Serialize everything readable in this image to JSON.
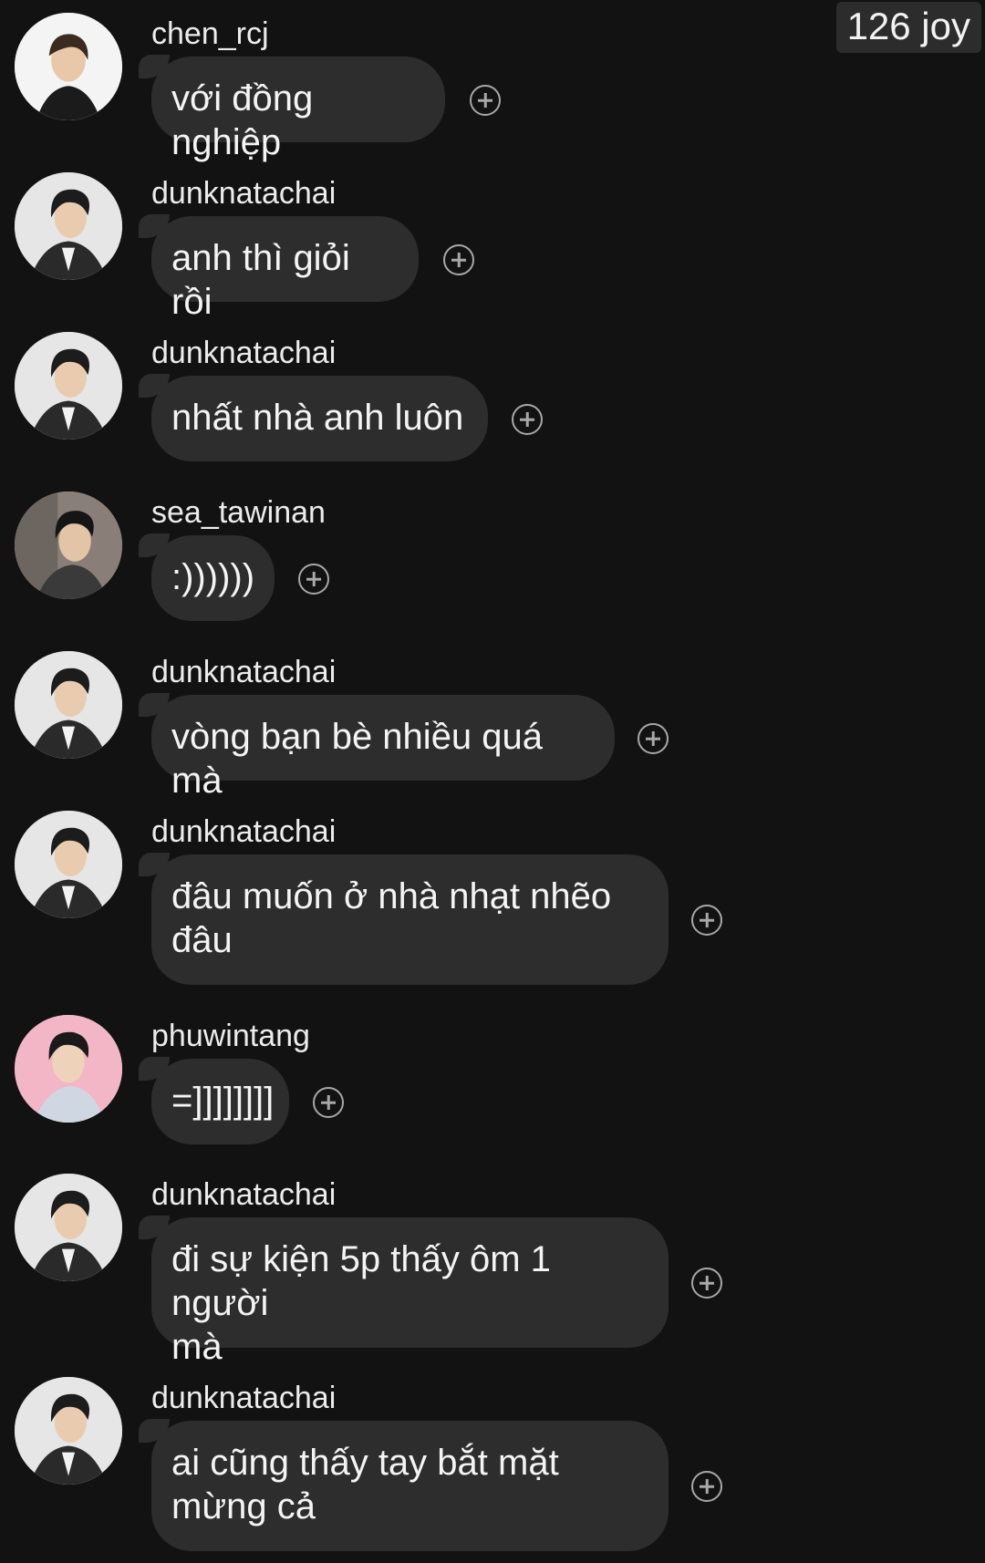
{
  "header": {
    "joy_count": "126 joy"
  },
  "messages": [
    {
      "username": "chen_rcj",
      "text": "với đồng nghiệp",
      "avatar": "avatar-chen"
    },
    {
      "username": "dunknatachai",
      "text": "anh thì giỏi rồi",
      "avatar": "avatar-dunk"
    },
    {
      "username": "dunknatachai",
      "text": "nhất nhà anh luôn",
      "avatar": "avatar-dunk"
    },
    {
      "username": "sea_tawinan",
      "text": ":))))))",
      "avatar": "avatar-sea"
    },
    {
      "username": "dunknatachai",
      "text": "vòng bạn bè nhiều quá mà",
      "avatar": "avatar-dunk"
    },
    {
      "username": "dunknatachai",
      "text": "đâu muốn ở nhà nhạt nhẽo\nđâu",
      "avatar": "avatar-dunk"
    },
    {
      "username": "phuwintang",
      "text": "=]]]]]]]]",
      "avatar": "avatar-phuwin"
    },
    {
      "username": "dunknatachai",
      "text": "đi sự kiện 5p thấy ôm 1 người\nmà",
      "avatar": "avatar-dunk"
    },
    {
      "username": "dunknatachai",
      "text": "ai cũng thấy tay bắt mặt\nmừng cả",
      "avatar": "avatar-dunk"
    }
  ],
  "icons": {
    "react": "add-reaction-icon"
  }
}
